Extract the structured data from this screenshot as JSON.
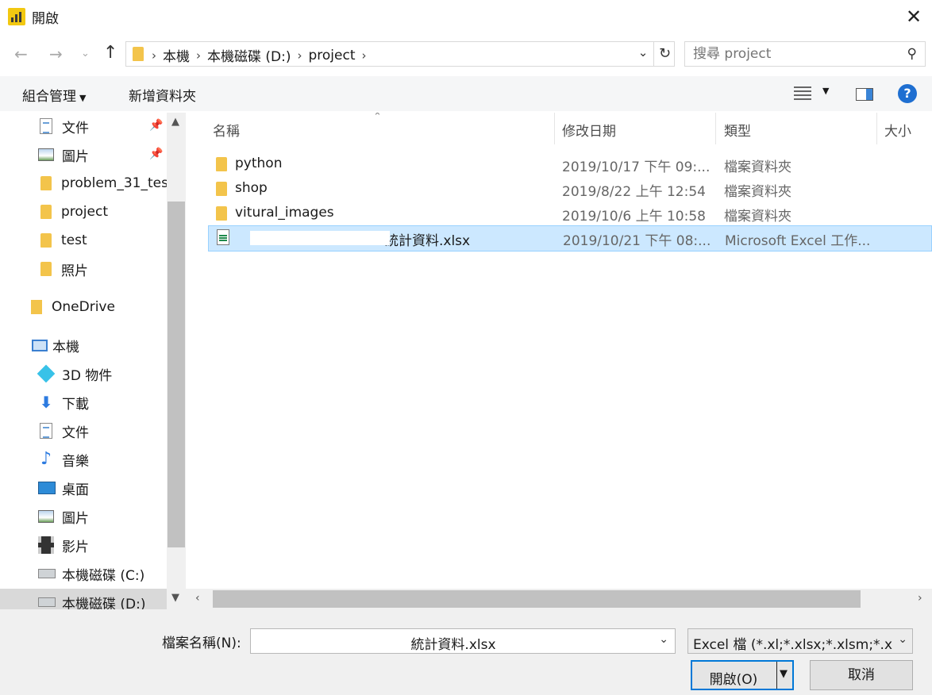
{
  "window": {
    "title": "開啟",
    "close": "✕"
  },
  "address": {
    "crumbs": [
      "本機",
      "本機磁碟 (D:)",
      "project"
    ],
    "sep": "›",
    "dropdown": "⌄",
    "refresh": "↻"
  },
  "search": {
    "placeholder": "搜尋 project"
  },
  "toolbar": {
    "organize_label": "組合管理",
    "new_folder_label": "新增資料夾",
    "help": "?"
  },
  "nav": {
    "items": [
      {
        "label": "文件",
        "icon": "document-icon"
      },
      {
        "label": "圖片",
        "icon": "pictures-icon"
      },
      {
        "label": "problem_31_tes",
        "icon": "folder-icon"
      },
      {
        "label": "project",
        "icon": "folder-icon"
      },
      {
        "label": "test",
        "icon": "folder-icon"
      },
      {
        "label": "照片",
        "icon": "folder-icon"
      },
      {
        "label": "OneDrive",
        "icon": "onedrive-icon"
      },
      {
        "label": "本機",
        "icon": "this-pc-icon"
      },
      {
        "label": "3D 物件",
        "icon": "3d-objects-icon"
      },
      {
        "label": "下載",
        "icon": "download-icon"
      },
      {
        "label": "文件",
        "icon": "document-icon"
      },
      {
        "label": "音樂",
        "icon": "music-icon"
      },
      {
        "label": "桌面",
        "icon": "desktop-icon"
      },
      {
        "label": "圖片",
        "icon": "pictures-icon"
      },
      {
        "label": "影片",
        "icon": "video-icon"
      },
      {
        "label": "本機磁碟 (C:)",
        "icon": "drive-icon"
      },
      {
        "label": "本機磁碟 (D:)",
        "icon": "drive-icon"
      }
    ]
  },
  "columns": {
    "name": "名稱",
    "date": "修改日期",
    "type": "類型",
    "size": "大小"
  },
  "files": [
    {
      "name": "python",
      "date": "2019/10/17 下午 09:...",
      "type": "檔案資料夾"
    },
    {
      "name": "shop",
      "date": "2019/8/22 上午 12:54",
      "type": "檔案資料夾"
    },
    {
      "name": "vitural_images",
      "date": "2019/10/6 上午 10:58",
      "type": "檔案資料夾"
    },
    {
      "name": "統計資料.xlsx",
      "date": "2019/10/21 下午 08:...",
      "type": "Microsoft Excel 工作..."
    }
  ],
  "bottom": {
    "filename_label": "檔案名稱(N):",
    "filename_value": "統計資料.xlsx",
    "filetype_value": "Excel 檔 (*.xl;*.xlsx;*.xlsm;*.xlsb",
    "open_label": "開啟(O)",
    "cancel_label": "取消"
  },
  "colors": {
    "accent": "#0078d7",
    "selection": "#cce8ff",
    "folder": "#f3c44b"
  }
}
